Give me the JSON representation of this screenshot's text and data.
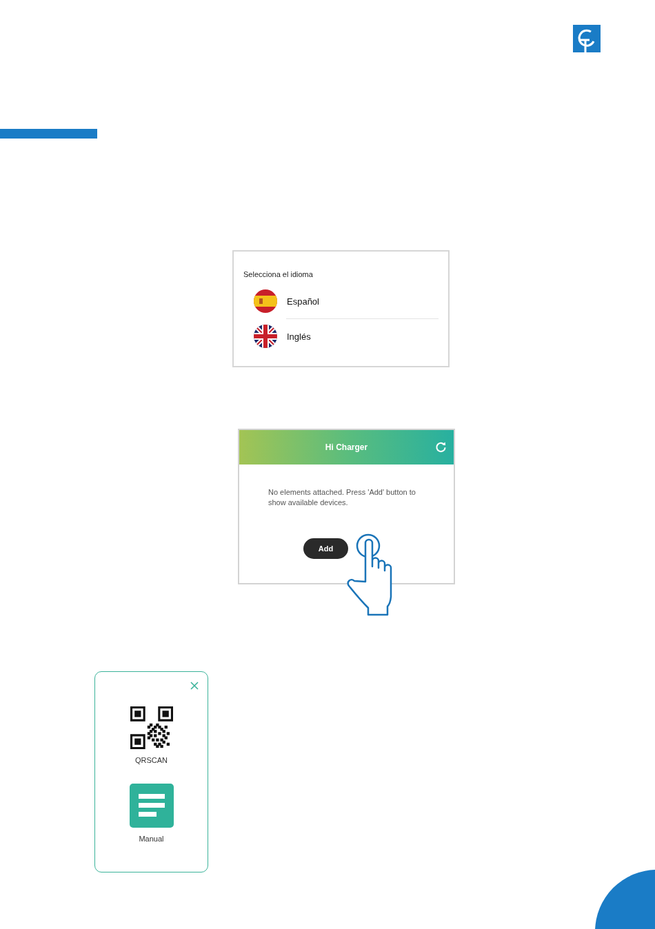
{
  "language_dialog": {
    "title": "Selecciona el idioma",
    "options": [
      {
        "label": "Español",
        "kind": "spain"
      },
      {
        "label": "Inglés",
        "kind": "uk"
      }
    ]
  },
  "charger_screen": {
    "title": "Hi Charger",
    "message": "No elements attached. Press 'Add' button to show available devices.",
    "add_button": "Add"
  },
  "add_menu": {
    "options": [
      {
        "label": "QRSCAN",
        "kind": "qr"
      },
      {
        "label": "Manual",
        "kind": "manual"
      }
    ]
  }
}
